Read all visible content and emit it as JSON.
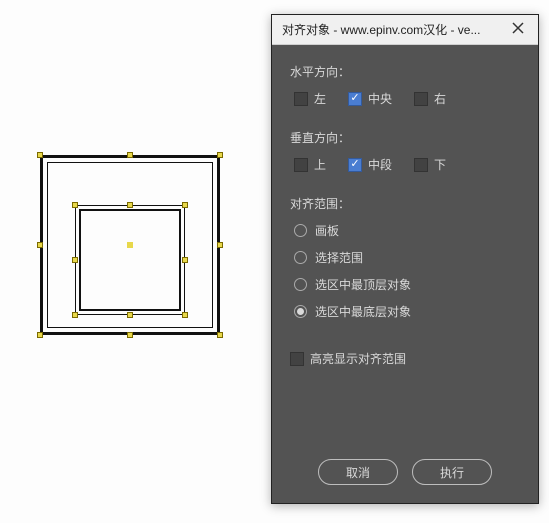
{
  "dialog": {
    "title": "对齐对象 - www.epinv.com汉化 - ve...",
    "horizontal": {
      "label": "水平方向：",
      "left": {
        "label": "左",
        "checked": false
      },
      "center": {
        "label": "中央",
        "checked": true
      },
      "right": {
        "label": "右",
        "checked": false
      }
    },
    "vertical": {
      "label": "垂直方向：",
      "top": {
        "label": "上",
        "checked": false
      },
      "middle": {
        "label": "中段",
        "checked": true
      },
      "bottom": {
        "label": "下",
        "checked": false
      }
    },
    "scope": {
      "label": "对齐范围：",
      "options": {
        "artboard": {
          "label": "画板",
          "selected": false
        },
        "selection": {
          "label": "选择范围",
          "selected": false
        },
        "topmost": {
          "label": "选区中最顶层对象",
          "selected": false
        },
        "bottommost": {
          "label": "选区中最底层对象",
          "selected": true
        }
      }
    },
    "highlight": {
      "label": "高亮显示对齐范围",
      "checked": false
    },
    "buttons": {
      "cancel": "取消",
      "execute": "执行"
    }
  }
}
